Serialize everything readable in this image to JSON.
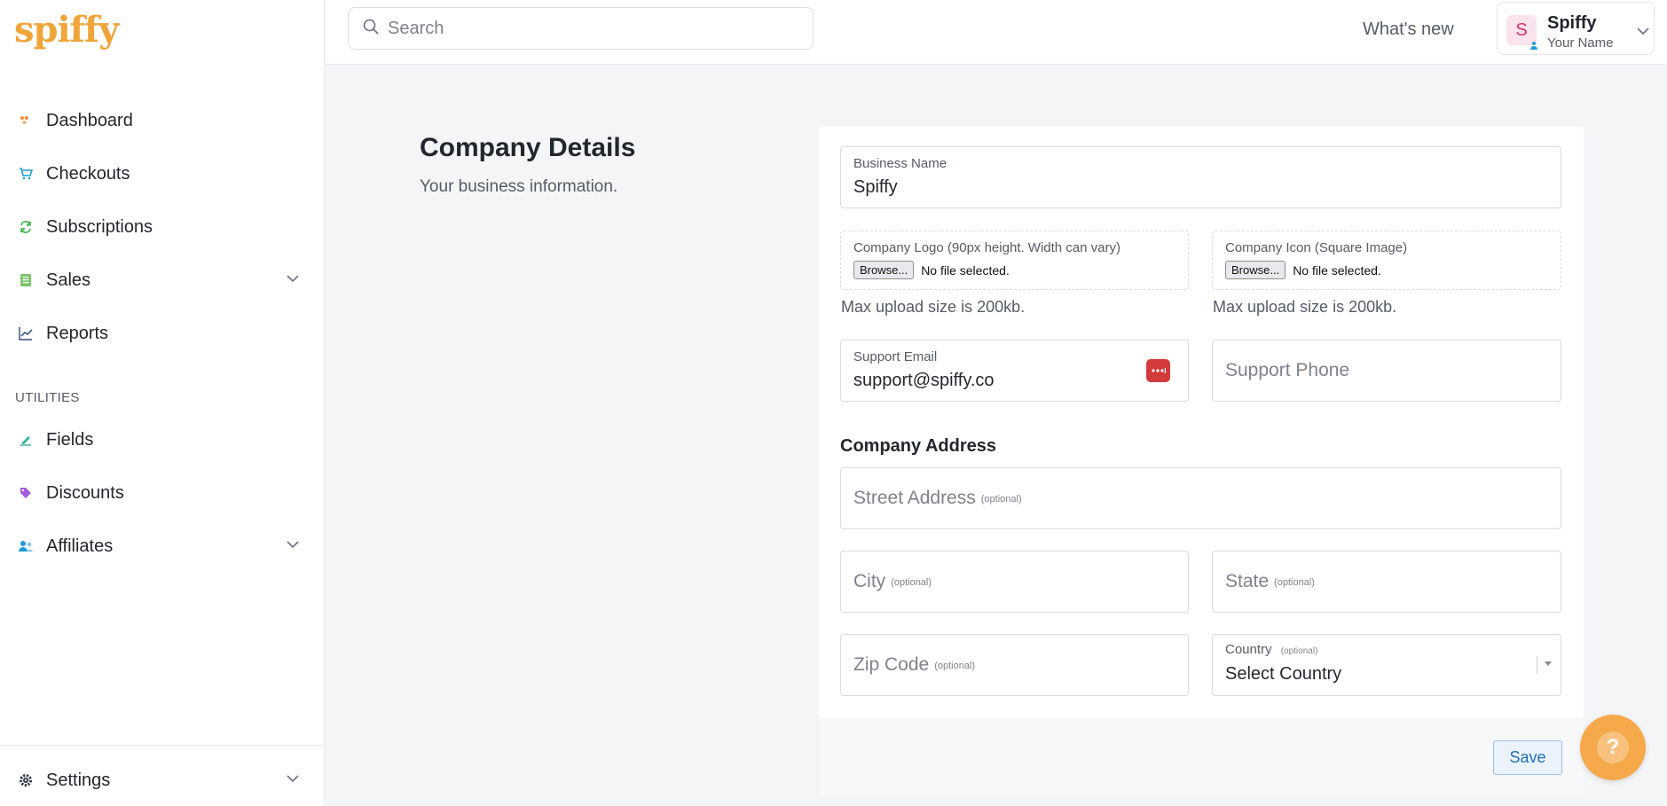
{
  "brand": {
    "logo_text": "spiffy",
    "color": "#f0a53a"
  },
  "sidebar": {
    "items": [
      {
        "label": "Dashboard",
        "icon": "dashboard-icon"
      },
      {
        "label": "Checkouts",
        "icon": "cart-icon"
      },
      {
        "label": "Subscriptions",
        "icon": "refresh-icon"
      },
      {
        "label": "Sales",
        "icon": "receipt-icon",
        "expandable": true
      },
      {
        "label": "Reports",
        "icon": "line-chart-icon"
      }
    ],
    "utilities_label": "UTILITIES",
    "utilities": [
      {
        "label": "Fields",
        "icon": "edit-icon"
      },
      {
        "label": "Discounts",
        "icon": "tag-icon"
      },
      {
        "label": "Affiliates",
        "icon": "users-icon",
        "expandable": true
      }
    ],
    "settings": {
      "label": "Settings",
      "icon": "gear-icon",
      "expandable": true
    }
  },
  "header": {
    "search_placeholder": "Search",
    "whats_new": "What's new",
    "account": {
      "avatar_letter": "S",
      "name": "Spiffy",
      "sub": "Your Name"
    }
  },
  "page": {
    "title": "Company Details",
    "subtitle": "Your business information."
  },
  "form": {
    "business_name": {
      "label": "Business Name",
      "value": "Spiffy"
    },
    "company_logo": {
      "label": "Company Logo (90px height. Width can vary)",
      "button": "Browse...",
      "status": "No file selected.",
      "helper": "Max upload size is 200kb."
    },
    "company_icon": {
      "label": "Company Icon (Square Image)",
      "button": "Browse...",
      "status": "No file selected.",
      "helper": "Max upload size is 200kb."
    },
    "support_email": {
      "label": "Support Email",
      "value": "support@spiffy.co"
    },
    "support_phone": {
      "placeholder": "Support Phone"
    },
    "address_heading": "Company Address",
    "street": {
      "placeholder": "Street Address",
      "optional": "(optional)"
    },
    "city": {
      "placeholder": "City",
      "optional": "(optional)"
    },
    "state": {
      "placeholder": "State",
      "optional": "(optional)"
    },
    "zip": {
      "placeholder": "Zip Code",
      "optional": "(optional)"
    },
    "country": {
      "label": "Country",
      "optional": "(optional)",
      "value": "Select Country"
    },
    "save_label": "Save"
  },
  "help_button": {
    "glyph": "?"
  }
}
